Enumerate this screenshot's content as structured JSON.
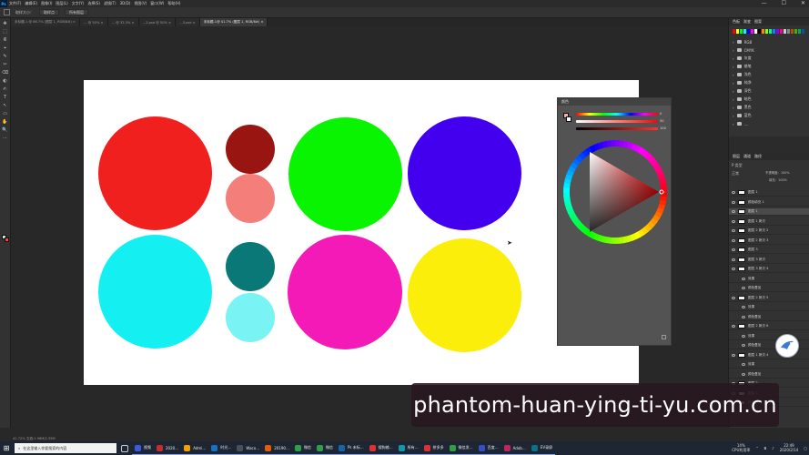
{
  "menubar": {
    "items": [
      "文件(F)",
      "编辑(E)",
      "图像(I)",
      "图层(L)",
      "文字(Y)",
      "选择(S)",
      "滤镜(T)",
      "3D(D)",
      "视图(V)",
      "窗口(W)",
      "帮助(H)"
    ],
    "controls": [
      "—",
      "☐",
      "✕"
    ]
  },
  "options": {
    "sample_size": "取样大小：",
    "sample_value": "取样点",
    "sample_all": "所有图层"
  },
  "tabs": [
    {
      "label": "未标题-1 @ 66.7% (图层 1, RGB/8#) ×",
      "active": false
    },
    {
      "label": "… @ 50% ×",
      "active": false
    },
    {
      "label": "… @ 33.3% ×",
      "active": false
    },
    {
      "label": "…2.psd @ 50% ×",
      "active": false
    },
    {
      "label": "…3.psd ×",
      "active": false
    },
    {
      "label": "未标题-1@ 41.7% (图层 1, RGB/8#) ×",
      "active": true
    }
  ],
  "tools": [
    "✥",
    "⬚",
    "ᓬ",
    "⌖",
    "✎",
    "✂",
    "⌫",
    "◐",
    "✍",
    "T",
    "↖",
    "▭",
    "✋",
    "🔍",
    "⋯"
  ],
  "circles": [
    {
      "name": "red-circle",
      "color": "#f0201e"
    },
    {
      "name": "dark-red-circle",
      "color": "#981512"
    },
    {
      "name": "salmon-circle",
      "color": "#f47e7a"
    },
    {
      "name": "green-circle",
      "color": "#08f400"
    },
    {
      "name": "blue-violet-circle",
      "color": "#4200ee"
    },
    {
      "name": "cyan-circle",
      "color": "#14f0f2"
    },
    {
      "name": "teal-circle",
      "color": "#0a7876"
    },
    {
      "name": "light-cyan-circle",
      "color": "#7af3f4"
    },
    {
      "name": "magenta-circle",
      "color": "#f31ab7"
    },
    {
      "name": "yellow-circle",
      "color": "#fbee0a"
    }
  ],
  "color_panel": {
    "title": "颜色",
    "h_value": "0",
    "s_value": "50",
    "b_value": "100"
  },
  "swatches": {
    "tabs": [
      "色板",
      "渐变",
      "图案"
    ],
    "colors": [
      "#ff0000",
      "#ffff00",
      "#00ff00",
      "#00ffff",
      "#0000ff",
      "#ff00ff",
      "#ffffff",
      "#000000",
      "#ff8800",
      "#88ff00",
      "#00ff88",
      "#0088ff",
      "#8800ff",
      "#ff0088",
      "#cccccc",
      "#888888",
      "#aa5500",
      "#55aa00",
      "#00aa55",
      "#0055aa"
    ],
    "folders": [
      "RGB",
      "CMYK",
      "灰度",
      "蜡笔",
      "浅色",
      "纯净",
      "深色",
      "暗色",
      "黑色",
      "蓝色",
      "...."
    ]
  },
  "layers": {
    "tabs": [
      "图层",
      "通道",
      "路径"
    ],
    "filter": "P 类型",
    "blend": "正常",
    "opacity": "不透明度：100%",
    "fill": "填充：100%",
    "rows": [
      {
        "label": "图层 1",
        "sub": false,
        "sel": false
      },
      {
        "label": "颜色填充 1",
        "sub": false,
        "sel": false
      },
      {
        "label": "图层 1",
        "sub": false,
        "sel": true
      },
      {
        "label": "图层 1 拷贝",
        "sub": false,
        "sel": false
      },
      {
        "label": "图层 2 拷贝 2",
        "sub": false,
        "sel": false
      },
      {
        "label": "图层 2 拷贝 3",
        "sub": false,
        "sel": false
      },
      {
        "label": "图层 3",
        "sub": false,
        "sel": false
      },
      {
        "label": "图层 3 拷贝",
        "sub": false,
        "sel": false
      },
      {
        "label": "图层 3 拷贝 4",
        "sub": false,
        "sel": false
      },
      {
        "label": "效果",
        "sub": true,
        "sel": false
      },
      {
        "label": "颜色叠加",
        "sub": true,
        "sel": false
      },
      {
        "label": "图层 2 拷贝 5",
        "sub": false,
        "sel": false
      },
      {
        "label": "效果",
        "sub": true,
        "sel": false
      },
      {
        "label": "颜色叠加",
        "sub": true,
        "sel": false
      },
      {
        "label": "图层 2 拷贝 6",
        "sub": false,
        "sel": false
      },
      {
        "label": "效果",
        "sub": true,
        "sel": false
      },
      {
        "label": "颜色叠加",
        "sub": true,
        "sel": false
      },
      {
        "label": "图层 1 拷贝 4",
        "sub": false,
        "sel": false
      },
      {
        "label": "效果",
        "sub": true,
        "sel": false
      },
      {
        "label": "颜色叠加",
        "sub": true,
        "sel": false
      },
      {
        "label": "图层 2",
        "sub": false,
        "sel": false
      },
      {
        "label": "图层 1",
        "sub": false,
        "sel": false
      },
      {
        "label": "背景",
        "sub": false,
        "sel": false
      }
    ]
  },
  "status": "41.72%   文档:1.98M/2.35M",
  "watermark": "phantom-huan-ying-ti-yu.com.cn",
  "taskbar": {
    "search_placeholder": "在这里输入你要搜索的内容",
    "apps": [
      {
        "label": "视频",
        "color": "#3b5bdb"
      },
      {
        "label": "2020…",
        "color": "#c92a2a"
      },
      {
        "label": "Admi…",
        "color": "#f59f00"
      },
      {
        "label": "时光…",
        "color": "#1971c2"
      },
      {
        "label": "Waco…",
        "color": "#495057"
      },
      {
        "label": "20190…",
        "color": "#e8590c"
      },
      {
        "label": "微信",
        "color": "#2f9e44"
      },
      {
        "label": "微信",
        "color": "#2f9e44"
      },
      {
        "label": "Ps 未标…",
        "color": "#1864ab"
      },
      {
        "label": "搜狗输…",
        "color": "#e03131"
      },
      {
        "label": "所有…",
        "color": "#1098ad"
      },
      {
        "label": "拼多多",
        "color": "#e03131"
      },
      {
        "label": "微信发…",
        "color": "#2f9e44"
      },
      {
        "label": "百度…",
        "color": "#364fc7"
      },
      {
        "label": "Adob…",
        "color": "#c2255c"
      },
      {
        "label": "EV录屏",
        "color": "#0b7285"
      }
    ],
    "cpu": "14%",
    "cpu_label": "CPU利用率",
    "time": "22:49",
    "date": "2020/2/14"
  }
}
